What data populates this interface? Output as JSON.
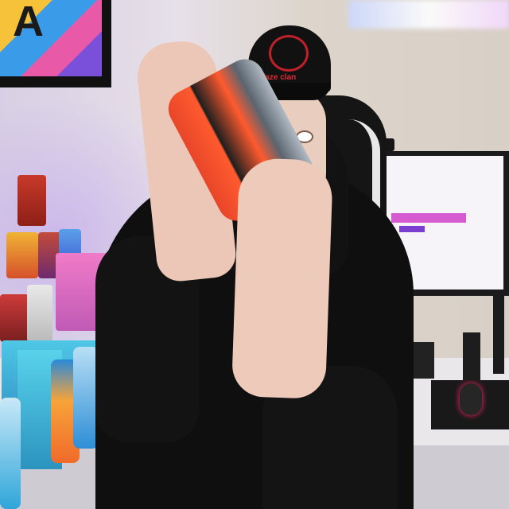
{
  "image": {
    "description_labels": {
      "cap_text": "faze clan",
      "poster_letter": "A"
    }
  }
}
